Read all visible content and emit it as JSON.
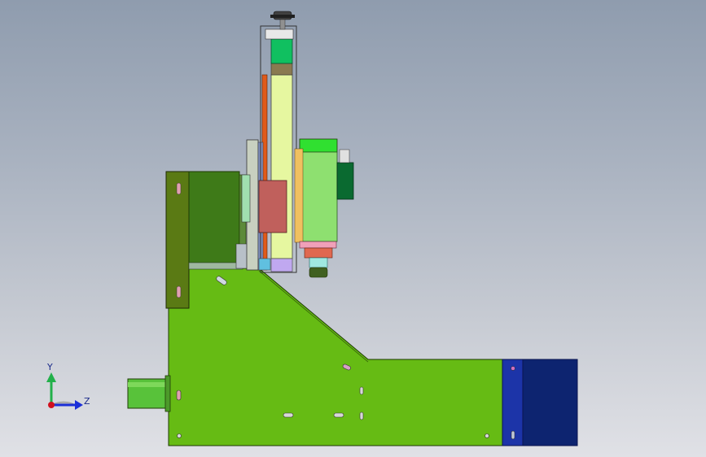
{
  "viewport": {
    "background_top": "#8f9cae",
    "background_bottom": "#e0e1e6"
  },
  "triad": {
    "y_label": "Y",
    "z_label": "Z",
    "y_color": "#22b04a",
    "z_color": "#1b2fd8",
    "x_color": "#d0101e"
  },
  "colors": {
    "base_plate": "#66bb14",
    "vertical_bracket": "#5a7a14",
    "motor_block": "#3e7a18",
    "rail_orange": "#e05a1a",
    "linear_column": "#e6f7a0",
    "carriage_red": "#c0605c",
    "spindle_green": "#8ee070",
    "end_block_blue": "#1c34a8",
    "end_block_navy": "#0d2470",
    "input_shaft": "#58c23a",
    "collet_pink": "#f0a0b8"
  }
}
